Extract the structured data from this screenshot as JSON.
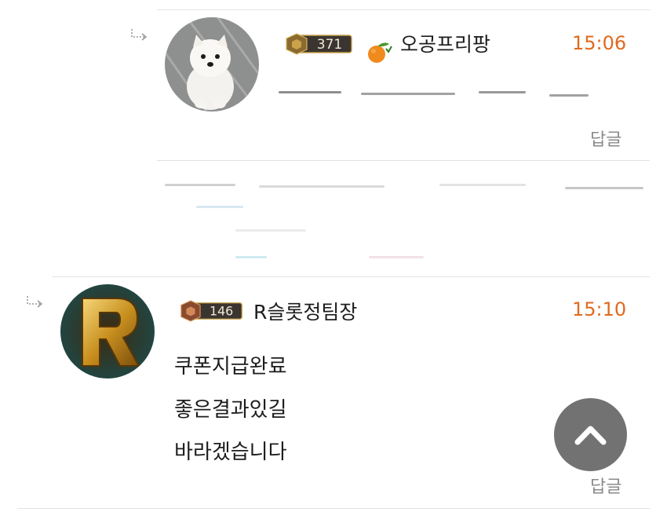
{
  "comments": [
    {
      "level": "371",
      "nickname": "오공프리팡",
      "time": "15:06",
      "body_lines": [],
      "reply_label": "답글"
    },
    {
      "level": "146",
      "nickname": "R슬롯정팀장",
      "time": "15:10",
      "body_lines": [
        "쿠폰지급완료",
        "좋은결과있길",
        "바라겠습니다"
      ],
      "reply_label": "답글"
    }
  ],
  "colors": {
    "time": "#e06a1e",
    "badge_dark": "#3a3530",
    "badge_gold": "#c9a24a",
    "scroll_button": "#5f5f5f"
  },
  "icons": {
    "reply_arrow": "reply-arrow-icon",
    "scroll_top": "chevron-up-icon",
    "tangerine": "tangerine-icon"
  }
}
